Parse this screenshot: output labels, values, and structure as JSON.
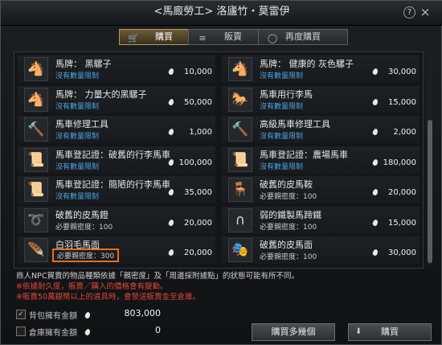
{
  "window": {
    "title": "<馬廄勞工> 洛廬竹・莫雷伊",
    "close_label": "×",
    "help_label": "?"
  },
  "tabs": [
    {
      "label": "購買",
      "icon": "cart-icon",
      "active": true
    },
    {
      "label": "販賣",
      "icon": "coins-icon",
      "active": false
    },
    {
      "label": "再度購買",
      "icon": "repeat-icon",
      "active": false
    }
  ],
  "items": [
    {
      "name": "馬牌： 黑騾子",
      "sub": "沒有數量限制",
      "price": "10,000",
      "icon": "🐴"
    },
    {
      "name": "馬牌： 健康的 灰色騾子",
      "sub": "沒有數量限制",
      "price": "30,000",
      "icon": "🐴"
    },
    {
      "name": "馬牌： 力量大的黑騾子",
      "sub": "沒有數量限制",
      "price": "50,000",
      "icon": "🐴"
    },
    {
      "name": "馬車用行李馬",
      "sub": "沒有數量限制",
      "price": "15,000",
      "icon": "🐎"
    },
    {
      "name": "馬車修理工具",
      "sub": "沒有數量限制",
      "price": "1,000",
      "icon": "🔨"
    },
    {
      "name": "高級馬車修理工具",
      "sub": "沒有數量限制",
      "price": "2,000",
      "icon": "🔨"
    },
    {
      "name": "馬車登記證：破舊的行李馬車",
      "sub": "沒有數量限制",
      "price": "100,000",
      "icon": "📜"
    },
    {
      "name": "馬車登記證：農場馬車",
      "sub": "沒有數量限制",
      "price": "180,000",
      "icon": "📜"
    },
    {
      "name": "馬車登記證：簡陋的行李馬車",
      "sub": "沒有數量限制",
      "price": "35,000",
      "icon": "📜"
    },
    {
      "name": "破舊的皮馬鞍",
      "sub": "必要親密度：100",
      "price": "20,000",
      "icon": "🪑"
    },
    {
      "name": "破舊的皮馬鐙",
      "sub": "必要親密度：100",
      "price": "20,000",
      "icon": "➰"
    },
    {
      "name": "弱的鐵製馬蹄鐵",
      "sub": "必要親密度：100",
      "price": "15,000",
      "icon": "∩"
    },
    {
      "name": "白羽毛馬面",
      "sub": "必要親密度：300",
      "price": "20,000",
      "icon": "🪶"
    },
    {
      "name": "破舊的皮馬面",
      "sub": "必要親密度：100",
      "price": "30,000",
      "icon": "🎭"
    }
  ],
  "notes": {
    "line1": "商人NPC買賣的物品種類依據「親密度」及「周邊採附據點」的狀態可能有所不同。",
    "line2": "※依據耐久度，販賣／購入的價格會有變動。",
    "line3": "※販賣50萬銀幣以上的道具時，會發送販賣金至倉庫。"
  },
  "money": {
    "bag_label": "背包擁有金額",
    "bag_value": "803,000",
    "bag_checked": true,
    "storage_label": "倉庫擁有金額",
    "storage_value": "0",
    "storage_checked": false
  },
  "buttons": {
    "buy_multiple": "購買多幾個",
    "buy": "購買"
  }
}
